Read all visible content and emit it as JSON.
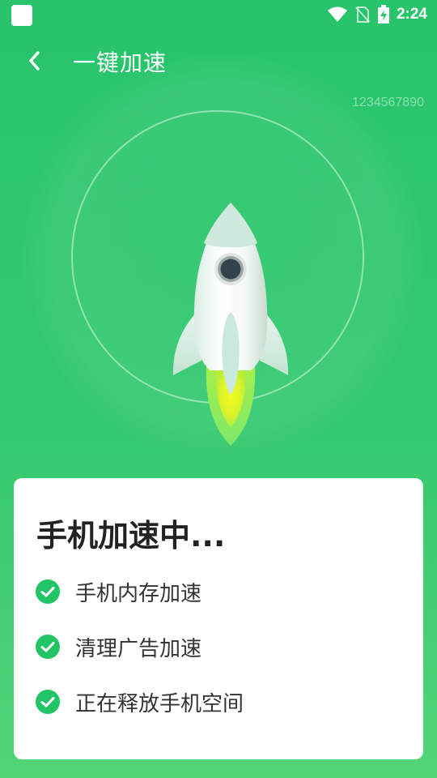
{
  "status_bar": {
    "time": "2:24",
    "icons": [
      "app-notification-icon",
      "wifi-icon",
      "no-sim-icon",
      "battery-charging-icon"
    ]
  },
  "header": {
    "title": "一键加速",
    "back_icon": "chevron-left-icon"
  },
  "boost": {
    "digits": "1234567890",
    "rocket_icon": "rocket-icon"
  },
  "card": {
    "title": "手机加速中...",
    "tasks": [
      {
        "label": "手机内存加速",
        "status": "done"
      },
      {
        "label": "清理广告加速",
        "status": "done"
      },
      {
        "label": "正在释放手机空间",
        "status": "done"
      }
    ]
  },
  "colors": {
    "background_top": "#27c46b",
    "background_bottom": "#52d477",
    "check_green": "#22c466",
    "flame_yellow": "#f4f626"
  }
}
